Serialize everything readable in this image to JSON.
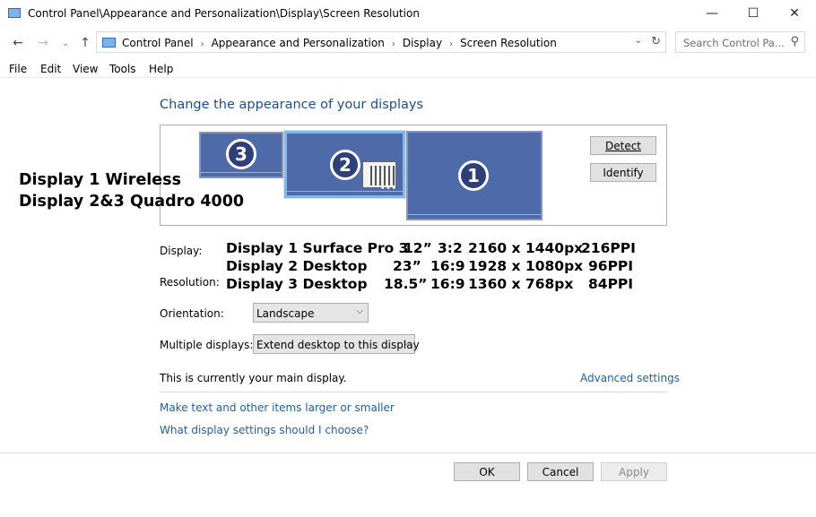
{
  "window": {
    "title": "Control Panel\\Appearance and Personalization\\Display\\Screen Resolution",
    "minimize": "—",
    "maximize": "☐",
    "close": "✕"
  },
  "nav": {
    "back": "←",
    "forward": "→",
    "recent": "⌄",
    "up": "↑"
  },
  "address": {
    "breadcrumbs": [
      "Control Panel",
      "Appearance and Personalization",
      "Display",
      "Screen Resolution"
    ],
    "separator": "›",
    "dropdown": "⌄",
    "refresh": "↻"
  },
  "search": {
    "placeholder": "Search Control Pa...",
    "icon": "⚲"
  },
  "menu": {
    "file": "File",
    "edit": "Edit",
    "view": "View",
    "tools": "Tools",
    "help": "Help"
  },
  "main": {
    "heading": "Change the appearance of your displays",
    "monitors": [
      {
        "number": "3",
        "selected": false
      },
      {
        "number": "2",
        "selected": true
      },
      {
        "number": "1",
        "selected": false
      }
    ],
    "monitor_dots": "•••",
    "detect": "Detect",
    "identify": "Identify",
    "overlay_line1": "Display 1 Wireless",
    "overlay_line2": "Display 2&3 Quadro 4000",
    "display_label": "Display:",
    "resolution_label": "Resolution:",
    "specs": [
      {
        "name": "Display 1 Surface Pro 3",
        "size": "12”",
        "ratio": "3:2",
        "pixels": "2160 x 1440px",
        "ppi": "216PPI"
      },
      {
        "name": "Display 2 Desktop",
        "size": "23”",
        "ratio": "16:9",
        "pixels": "1928 x 1080px",
        "ppi": "96PPI"
      },
      {
        "name": "Display 3 Desktop",
        "size": "18.5”",
        "ratio": "16:9",
        "pixels": "1360 x 768px",
        "ppi": "84PPI"
      }
    ],
    "orientation_label": "Orientation:",
    "orientation_value": "Landscape",
    "multiple_label": "Multiple displays:",
    "multiple_value": "Extend desktop to this display",
    "main_display_note": "This is currently your main display.",
    "advanced_link": "Advanced settings",
    "link_text_size": "Make text and other items larger or smaller",
    "link_what_settings": "What display settings should I choose?"
  },
  "footer": {
    "ok": "OK",
    "cancel": "Cancel",
    "apply": "Apply"
  },
  "colors": {
    "link": "#1f5fa6",
    "heading": "#1e4e8c",
    "monitor_fill": "#4f6aa8",
    "selected_border": "#80b8ec"
  }
}
